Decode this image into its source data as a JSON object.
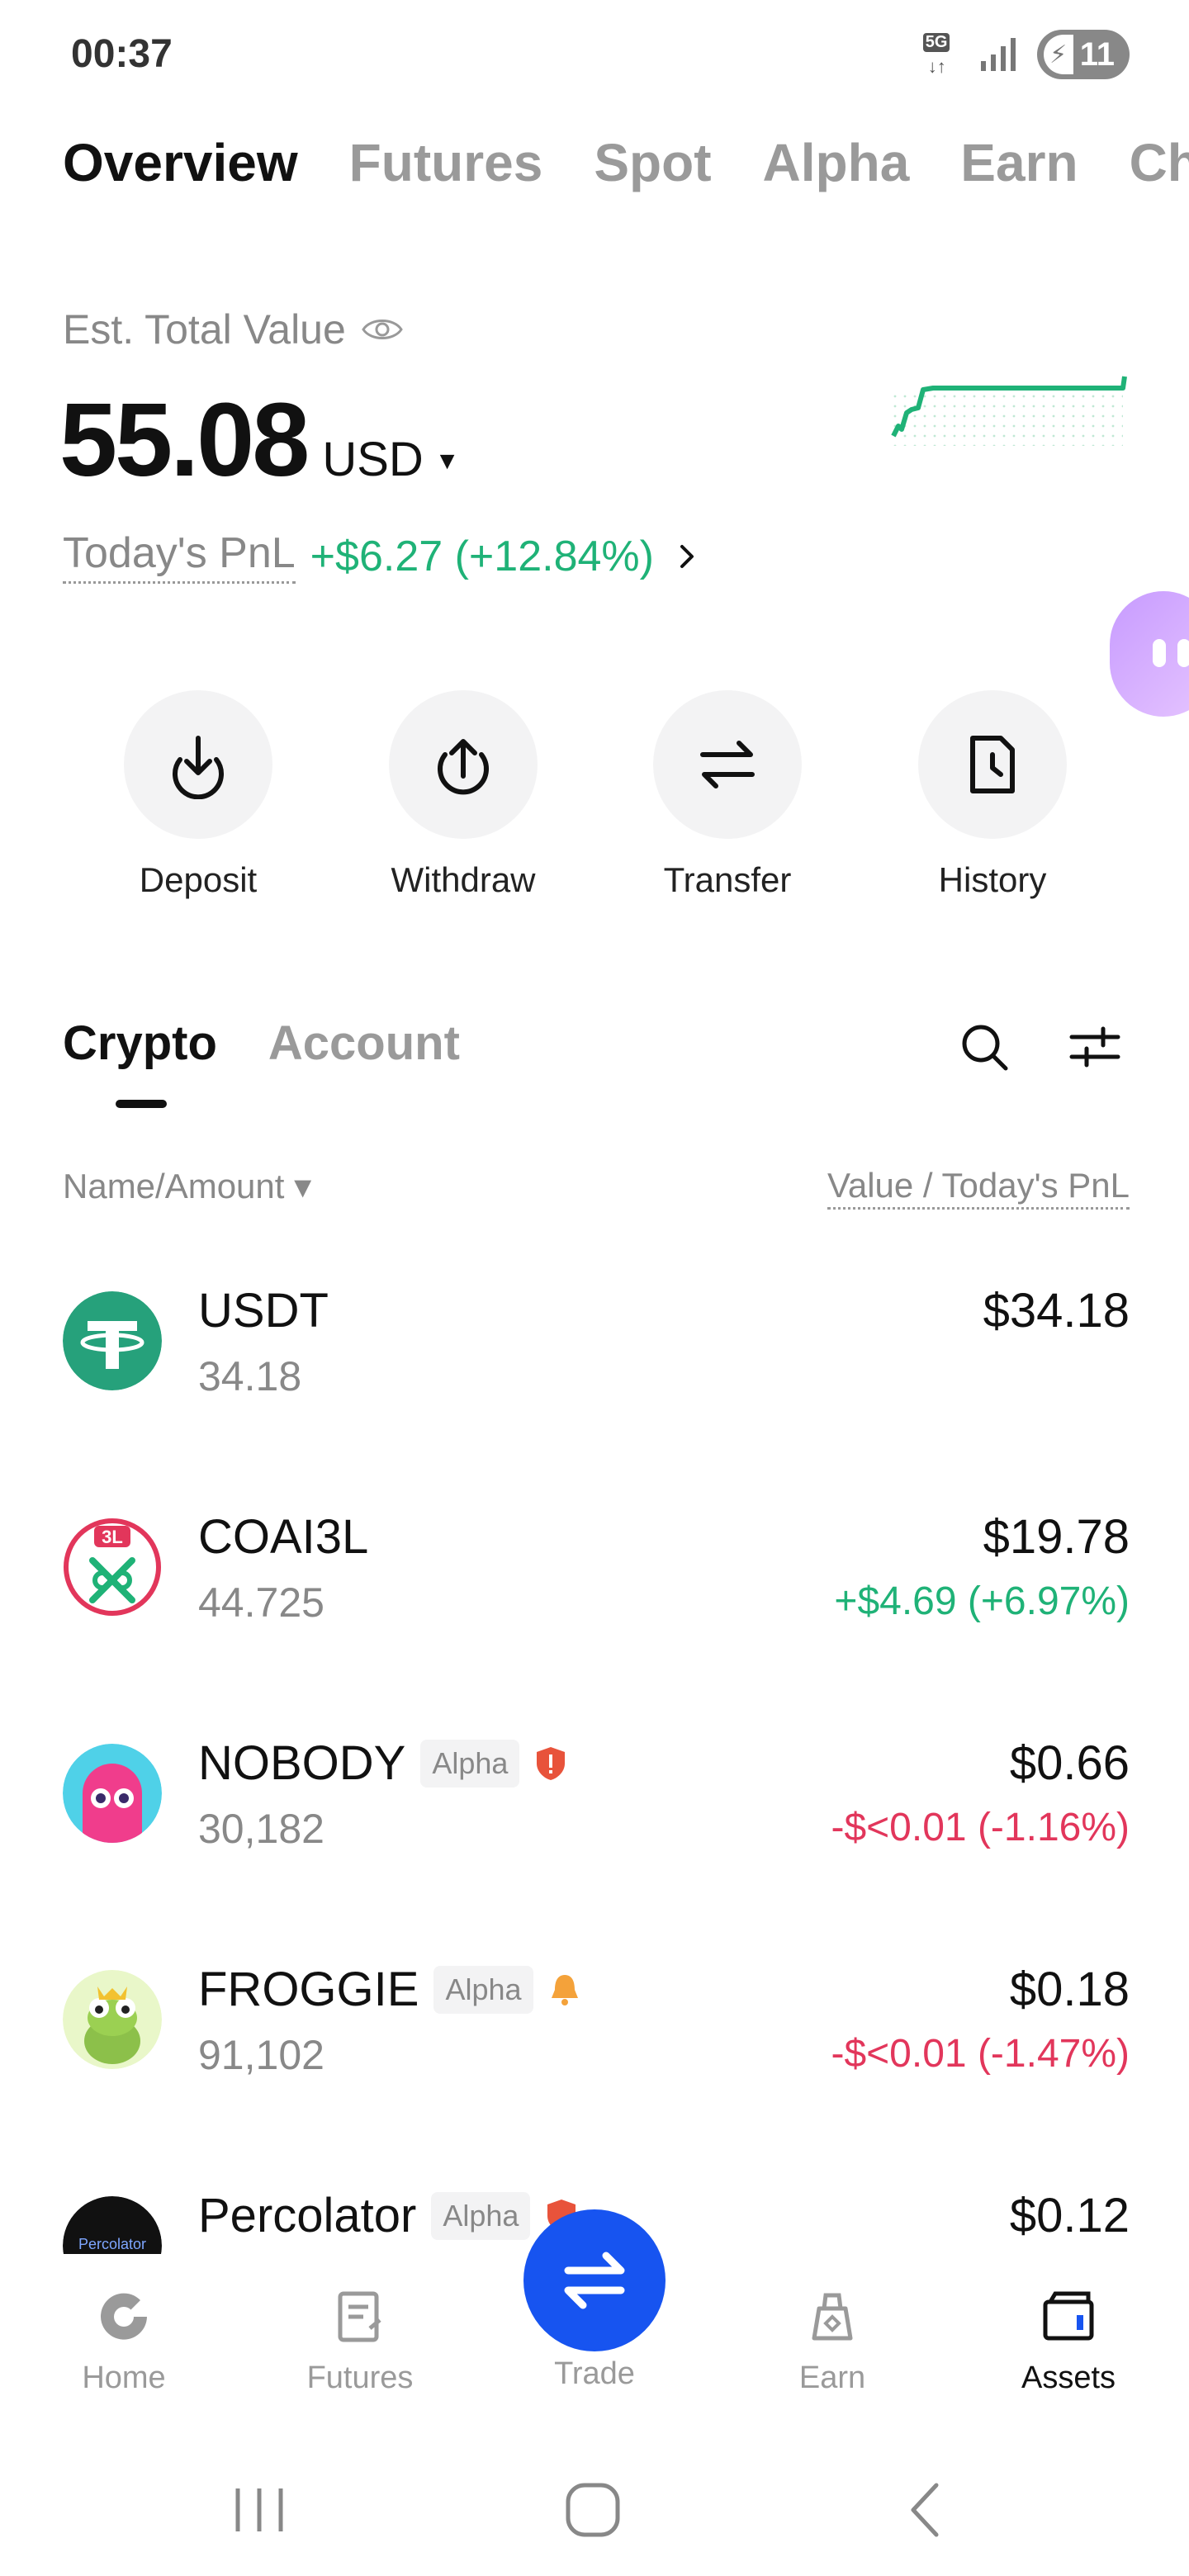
{
  "status_bar": {
    "time": "00:37",
    "network": "5G",
    "battery": "11"
  },
  "top_tabs": [
    "Overview",
    "Futures",
    "Spot",
    "Alpha",
    "Earn",
    "Ch"
  ],
  "overview": {
    "est_label": "Est. Total Value",
    "total_value": "55.08",
    "currency": "USD",
    "pnl_label": "Today's PnL",
    "pnl_value": "+$6.27 (+12.84%)"
  },
  "actions": [
    "Deposit",
    "Withdraw",
    "Transfer",
    "History"
  ],
  "sub_tabs": [
    "Crypto",
    "Account"
  ],
  "list_header": {
    "name": "Name/Amount",
    "value": "Value / Today's PnL"
  },
  "assets": [
    {
      "symbol": "USDT",
      "amount": "34.18",
      "value": "$34.18",
      "pnl": "",
      "badge": ""
    },
    {
      "symbol": "COAI3L",
      "amount": "44.725",
      "value": "$19.78",
      "pnl": "+$4.69 (+6.97%)",
      "badge": ""
    },
    {
      "symbol": "NOBODY",
      "amount": "30,182",
      "value": "$0.66",
      "pnl": "-$<0.01 (-1.16%)",
      "badge": "Alpha"
    },
    {
      "symbol": "FROGGIE",
      "amount": "91,102",
      "value": "$0.18",
      "pnl": "-$<0.01 (-1.47%)",
      "badge": "Alpha"
    },
    {
      "symbol": "Percolator",
      "amount": "",
      "value": "$0.12",
      "pnl": "",
      "badge": "Alpha",
      "logo_text": "Percolator"
    }
  ],
  "coai_logo_text": "3L",
  "bottom_nav": [
    "Home",
    "Futures",
    "Trade",
    "Earn",
    "Assets"
  ],
  "colors": {
    "positive": "#1fb277",
    "negative": "#e2365b",
    "accent": "#1754f0"
  }
}
